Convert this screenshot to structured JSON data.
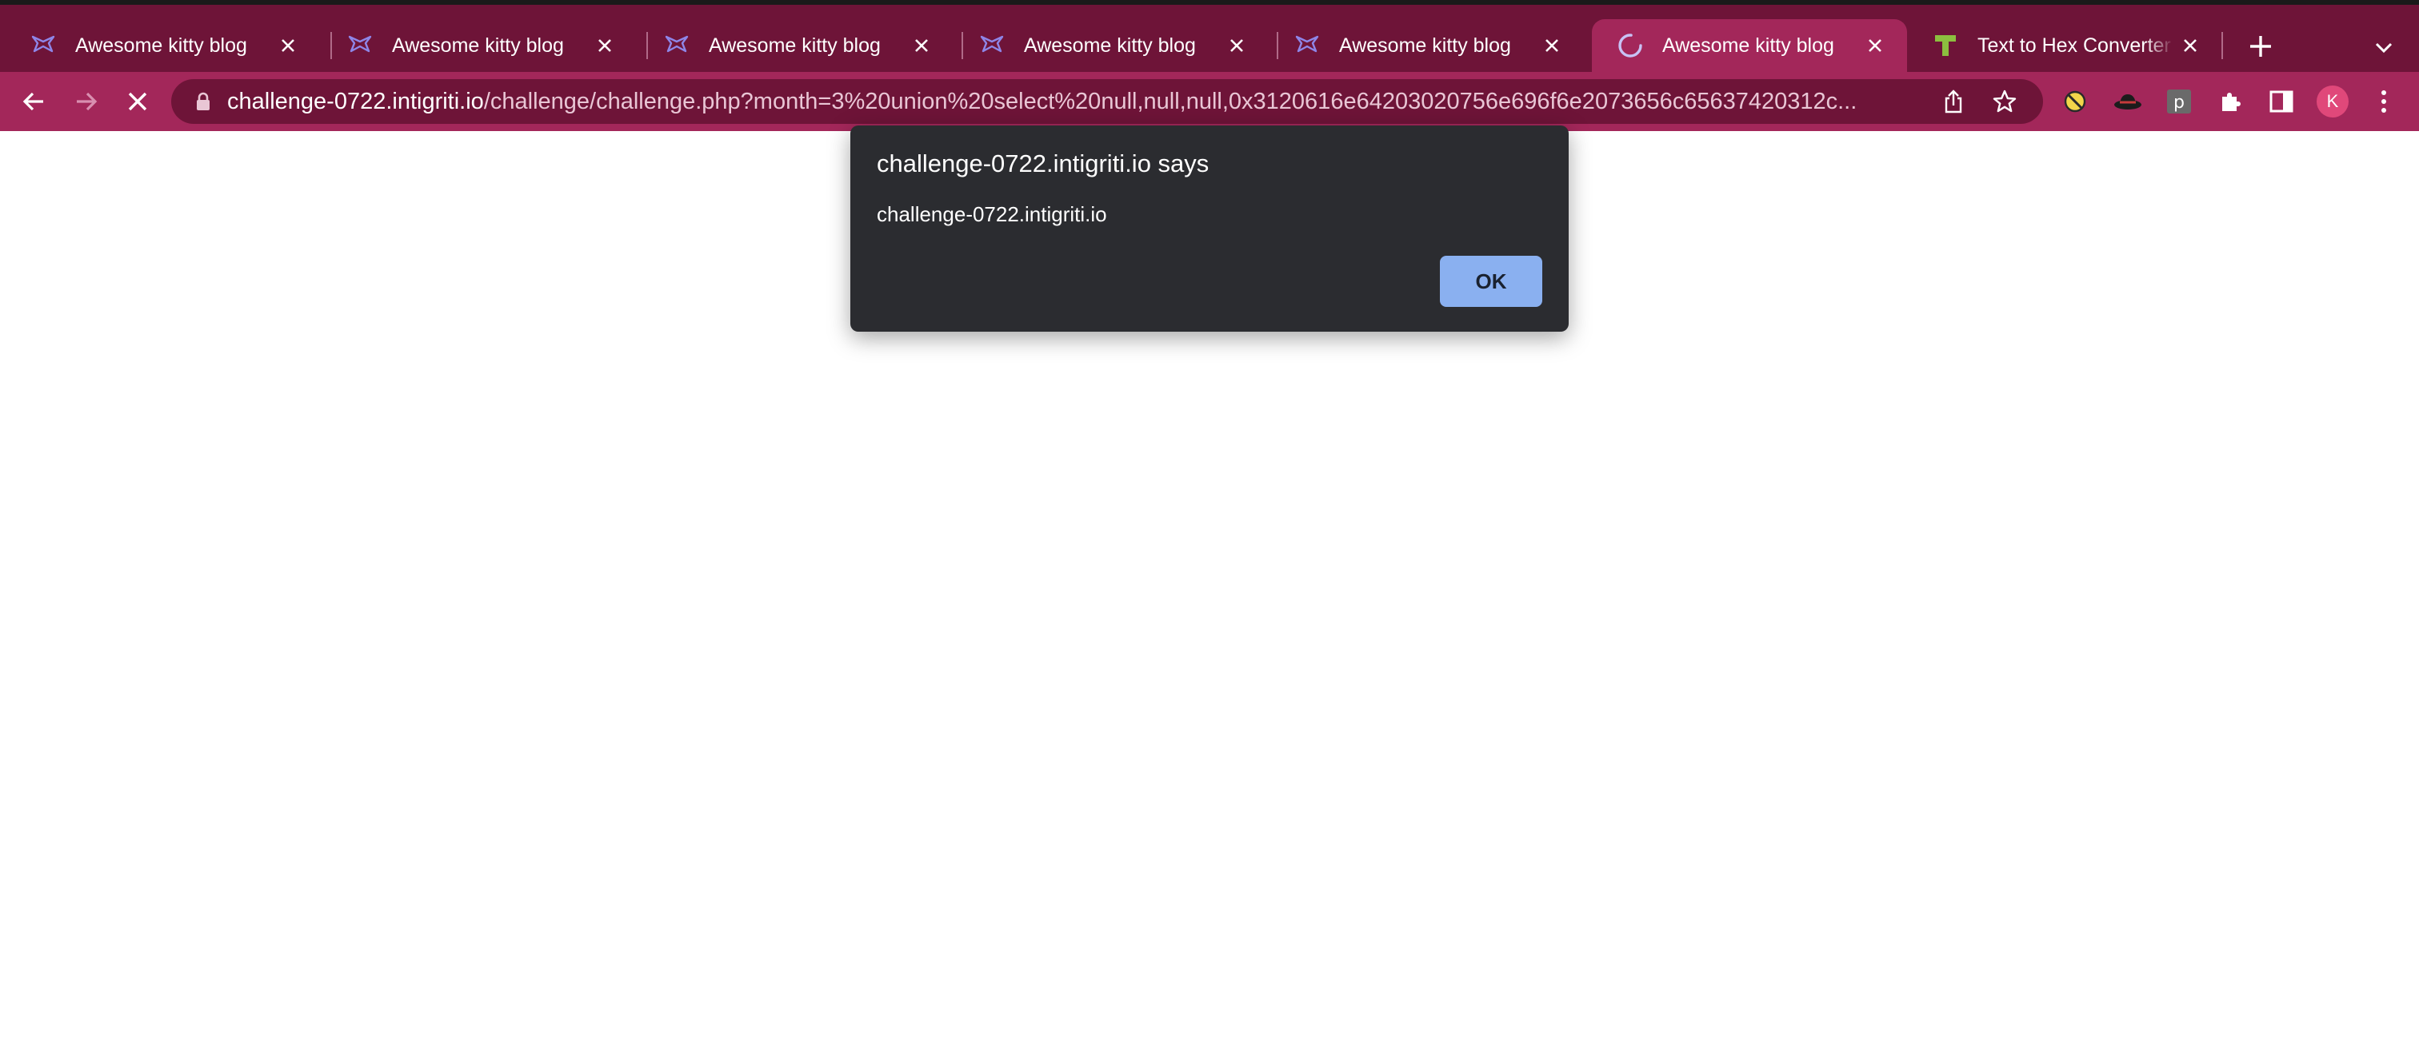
{
  "browser": {
    "tabs": [
      {
        "title": "Awesome kitty blog",
        "favicon": "kitty-blog-favicon-icon",
        "active": false
      },
      {
        "title": "Awesome kitty blog",
        "favicon": "kitty-blog-favicon-icon",
        "active": false
      },
      {
        "title": "Awesome kitty blog",
        "favicon": "kitty-blog-favicon-icon",
        "active": false
      },
      {
        "title": "Awesome kitty blog",
        "favicon": "kitty-blog-favicon-icon",
        "active": false
      },
      {
        "title": "Awesome kitty blog",
        "favicon": "kitty-blog-favicon-icon",
        "active": false
      },
      {
        "title": "Awesome kitty blog",
        "favicon": "loading-spinner-icon",
        "active": true
      },
      {
        "title": "Text to Hex Converter -",
        "favicon": "text-converter-favicon-icon",
        "active": false
      }
    ],
    "address_bar": {
      "host": "challenge-0722.intigriti.io",
      "path": "/challenge/challenge.php?month=3%20union%20select%20null,null,null,0x3120616e64203020756e696f6e2073656c65637420312c..."
    },
    "profile_initial": "K",
    "icons": [
      "back-arrow-icon",
      "forward-arrow-icon",
      "stop-loading-icon",
      "lock-icon",
      "share-icon",
      "bookmark-star-icon",
      "extension-icon",
      "puzzle-icon",
      "side-panel-icon",
      "menu-dots-icon",
      "new-tab-plus-icon",
      "tab-search-chevron-icon"
    ],
    "colors": {
      "frame": "#6e1438",
      "toolbar": "#a3275a",
      "dialog_bg": "#2b2c30",
      "ok_button": "#8ab0f0"
    }
  },
  "dialog": {
    "heading": "challenge-0722.intigriti.io says",
    "message": "challenge-0722.intigriti.io",
    "ok_label": "OK"
  }
}
